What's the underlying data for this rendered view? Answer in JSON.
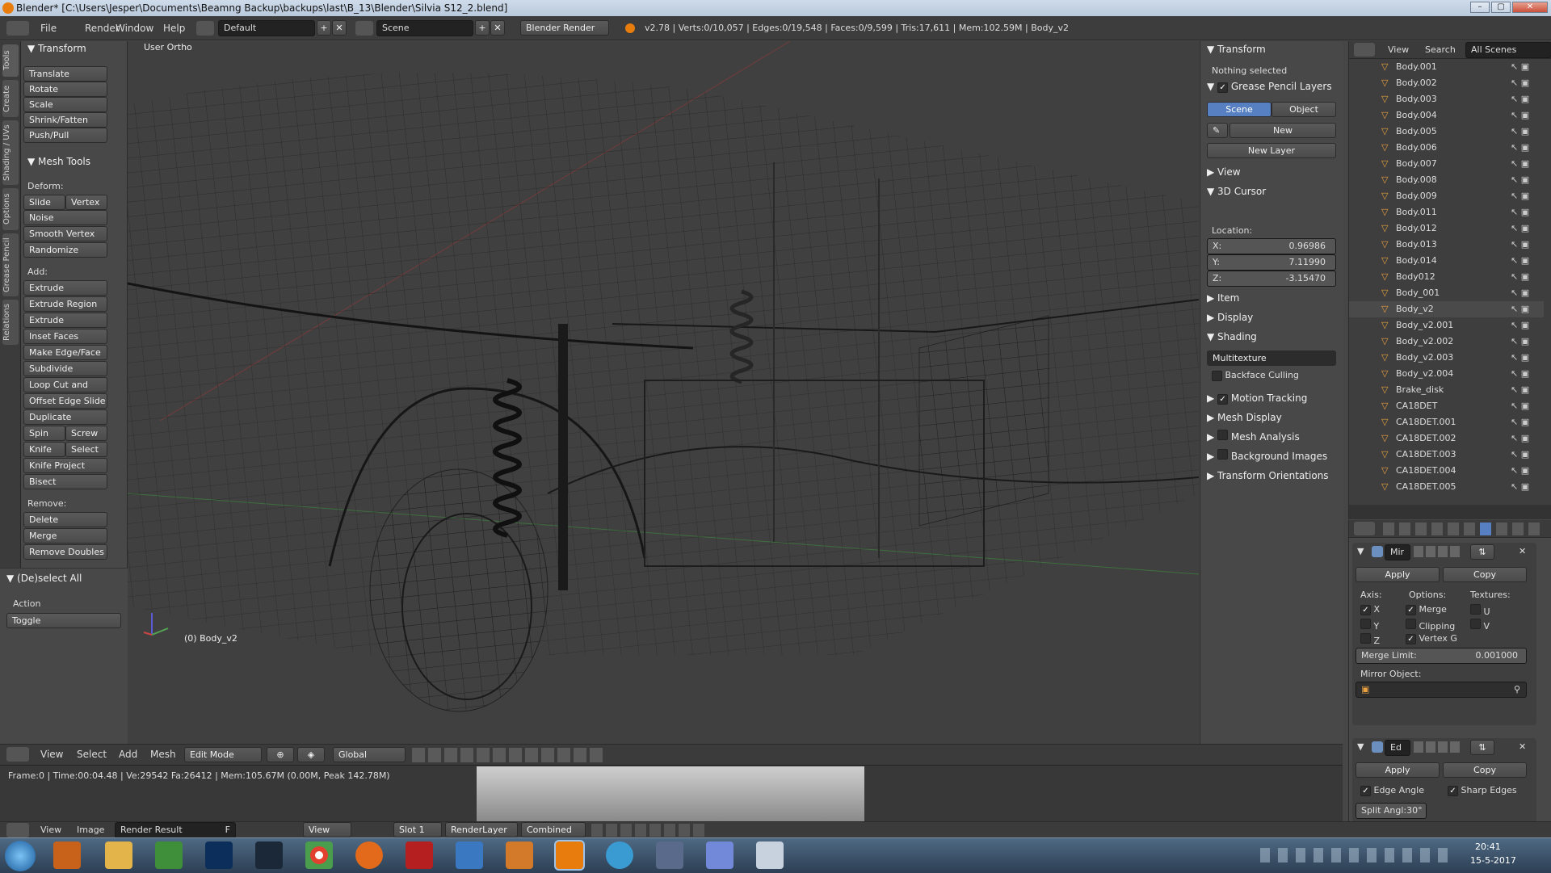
{
  "title_bar": {
    "text": "Blender* [C:\\Users\\Jesper\\Documents\\Beamng Backup\\backups\\last\\B_13\\Blender\\Silvia S12_2.blend]",
    "min": "–",
    "max": "▢",
    "close": "✕"
  },
  "info_header": {
    "menus": [
      "File",
      "Render",
      "Window",
      "Help"
    ],
    "layout": "Default",
    "scene": "Scene",
    "engine": "Blender Render",
    "stats": "v2.78 | Verts:0/10,057 | Edges:0/19,548 | Faces:0/9,599 | Tris:17,611 | Mem:102.59M | Body_v2"
  },
  "tool_tabs": [
    "Tools",
    "Create",
    "Shading / UVs",
    "Options",
    "Grease Pencil",
    "Relations"
  ],
  "tool_shelf": {
    "transform_header": "Transform",
    "transform_buttons": [
      "Translate",
      "Rotate",
      "Scale",
      "Shrink/Fatten",
      "Push/Pull"
    ],
    "mesh_tools_header": "Mesh Tools",
    "deform_label": "Deform:",
    "deform_pair": [
      "Slide Ed",
      "Vertex"
    ],
    "deform_buttons": [
      "Noise",
      "Smooth Vertex",
      "Randomize"
    ],
    "add_label": "Add:",
    "extrude": "Extrude",
    "add_buttons": [
      "Extrude Region",
      "Extrude Individual",
      "Inset Faces",
      "Make Edge/Face",
      "Subdivide",
      "Loop Cut and Slide",
      "Offset Edge Slide",
      "Duplicate"
    ],
    "spin_pair": [
      "Spin",
      "Screw"
    ],
    "knife_pair": [
      "Knife",
      "Select"
    ],
    "add_buttons2": [
      "Knife Project",
      "Bisect"
    ],
    "remove_label": "Remove:",
    "delete": "Delete",
    "merge": "Merge",
    "remove_doubles": "Remove Doubles",
    "deselect_header": "(De)select All",
    "action_label": "Action",
    "action_value": "Toggle"
  },
  "viewport": {
    "view_name": "User Ortho",
    "object_label": "(0) Body_v2"
  },
  "n_panel": {
    "transform_header": "Transform",
    "nothing_selected": "Nothing selected",
    "gp_header": "Grease Pencil Layers",
    "scene_tab": "Scene",
    "object_tab": "Object",
    "new_btn": "New",
    "new_layer": "New Layer",
    "view_header": "View",
    "cursor_header": "3D Cursor",
    "location_label": "Location:",
    "x_label": "X:",
    "x_value": "0.96986",
    "y_label": "Y:",
    "y_value": "7.11990",
    "z_label": "Z:",
    "z_value": "-3.15470",
    "item_header": "Item",
    "display_header": "Display",
    "shading_header": "Shading",
    "shading_mode": "Multitexture",
    "backface": "Backface Culling",
    "motion_tracking": "Motion Tracking",
    "mesh_display": "Mesh Display",
    "mesh_analysis": "Mesh Analysis",
    "background_images": "Background Images",
    "transform_orient": "Transform Orientations"
  },
  "outliner": {
    "menus": [
      "View",
      "Search"
    ],
    "scope": "All Scenes",
    "items": [
      "Body.001",
      "Body.002",
      "Body.003",
      "Body.004",
      "Body.005",
      "Body.006",
      "Body.007",
      "Body.008",
      "Body.009",
      "Body.011",
      "Body.012",
      "Body.013",
      "Body.014",
      "Body012",
      "Body_001",
      "Body_v2",
      "Body_v2.001",
      "Body_v2.002",
      "Body_v2.003",
      "Body_v2.004",
      "Brake_disk",
      "CA18DET",
      "CA18DET.001",
      "CA18DET.002",
      "CA18DET.003",
      "CA18DET.004",
      "CA18DET.005"
    ],
    "selected": "Body_v2"
  },
  "properties": {
    "mod1_name": "Mir",
    "apply": "Apply",
    "copy": "Copy",
    "axis_label": "Axis:",
    "options_label": "Options:",
    "textures_label": "Textures:",
    "x": "X",
    "y": "Y",
    "z": "Z",
    "merge": "Merge",
    "clipping": "Clipping",
    "vertex_g": "Vertex G",
    "u": "U",
    "v": "V",
    "merge_limit_label": "Merge Limit:",
    "merge_limit_value": "0.001000",
    "mirror_object": "Mirror Object:",
    "mod2_name": "Ed",
    "edge_angle": "Edge Angle",
    "sharp_edges": "Sharp Edges",
    "split_angle": "Split Angl:30°"
  },
  "view3d_header": {
    "menus": [
      "View",
      "Select",
      "Add",
      "Mesh"
    ],
    "mode": "Edit Mode",
    "orientation": "Global"
  },
  "info_report": "Frame:0 | Time:00:04.48 | Ve:29542 Fa:26412 | Mem:105.67M (0.00M, Peak 142.78M)",
  "image_header": {
    "menus": [
      "View",
      "Image"
    ],
    "image_name": "Render Result",
    "f_label": "F",
    "view": "View",
    "slot": "Slot 1",
    "layer": "RenderLayer",
    "pass": "Combined"
  },
  "taskbar": {
    "time": "20:41",
    "date": "15-5-2017"
  }
}
